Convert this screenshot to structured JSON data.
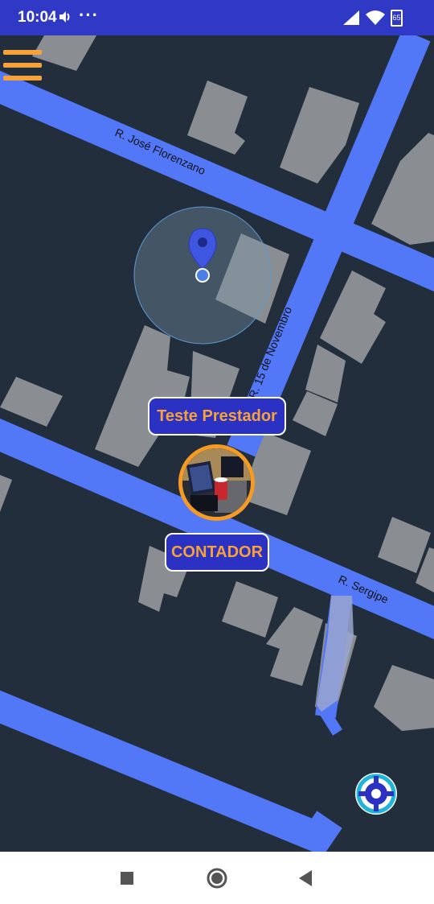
{
  "status_bar": {
    "time": "10:04",
    "dots": "···",
    "battery": "65"
  },
  "map": {
    "streets": {
      "jose_florenzano": "R. José Florenzano",
      "quinze_novembro": "R. 15 de Novembro",
      "sergipe": "R. Sergipe"
    },
    "colors": {
      "background": "#232e3d",
      "road": "#5277f7",
      "building": "#8a8e92",
      "accent": "#f5a23a",
      "pill": "#2b31c2"
    }
  },
  "markers": {
    "provider_name": "Teste Prestador",
    "provider_role": "CONTADOR"
  },
  "icons": {
    "menu": "hamburger-menu-icon",
    "location": "location-pin-icon",
    "locate": "my-location-crosshair-icon"
  },
  "nav_bar": {
    "buttons": [
      "recents-square-icon",
      "home-circle-icon",
      "back-triangle-icon"
    ]
  }
}
